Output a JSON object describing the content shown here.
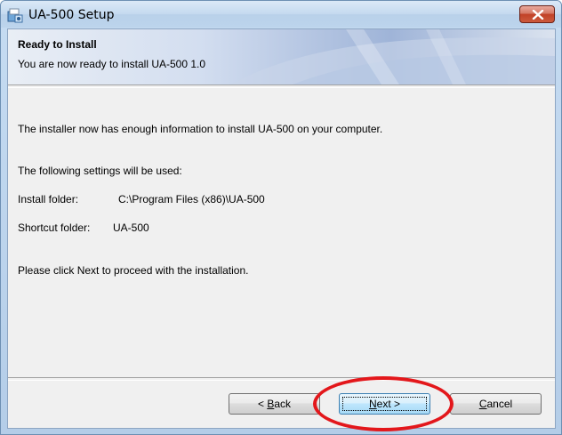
{
  "window": {
    "title": "UA-500 Setup",
    "icon": "installer-app-icon",
    "close_icon": "close-icon"
  },
  "banner": {
    "title": "Ready to Install",
    "subtitle": "You are now ready to install UA-500 1.0"
  },
  "body": {
    "intro": "The installer now has enough information to install UA-500 on your computer.",
    "settings_heading": "The following settings will be used:",
    "install_folder_label": "Install folder:",
    "install_folder_value": "C:\\Program Files (x86)\\UA-500",
    "shortcut_folder_label": "Shortcut folder:",
    "shortcut_folder_value": "UA-500",
    "instruction": "Please click Next to proceed with the installation."
  },
  "buttons": {
    "back": {
      "mnemonic": "B",
      "rest": "ack",
      "prefix": "< "
    },
    "next": {
      "mnemonic": "N",
      "rest": "ext >"
    },
    "cancel": {
      "mnemonic": "C",
      "rest": "ancel"
    }
  },
  "colors": {
    "highlight": "#e3171b",
    "close_button": "#c14127"
  }
}
